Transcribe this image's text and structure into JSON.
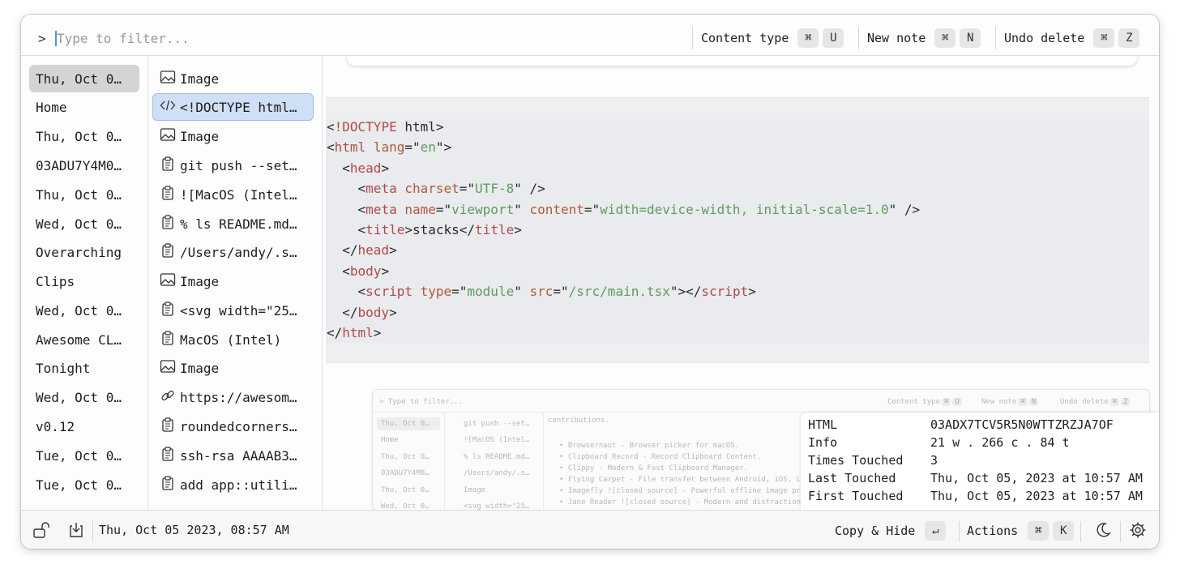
{
  "filter": {
    "prompt": ">",
    "placeholder": "Type to filter..."
  },
  "toolbar": {
    "content_type": {
      "label": "Content type",
      "keys": [
        "⌘",
        "U"
      ]
    },
    "new_note": {
      "label": "New note",
      "keys": [
        "⌘",
        "N"
      ]
    },
    "undo_delete": {
      "label": "Undo delete",
      "keys": [
        "⌘",
        "Z"
      ]
    }
  },
  "stacks": [
    "Thu, Oct 0…",
    "Home",
    "Thu, Oct 0…",
    "03ADU7Y4M0…",
    "Thu, Oct 0…",
    "Wed, Oct 0…",
    "Overarching",
    "Clips",
    "Wed, Oct 0…",
    "Awesome CL…",
    "Tonight",
    "Wed, Oct 0…",
    "v0.12",
    "Tue, Oct 0…",
    "Tue, Oct 0…"
  ],
  "items": [
    {
      "icon": "image-icon",
      "text": "Image"
    },
    {
      "icon": "code-icon",
      "text": "<!DOCTYPE html…"
    },
    {
      "icon": "image-icon",
      "text": "Image"
    },
    {
      "icon": "clipboard-icon",
      "text": "git push --set…"
    },
    {
      "icon": "clipboard-icon",
      "text": "![MacOS (Intel…"
    },
    {
      "icon": "clipboard-icon",
      "text": "% ls README.md…"
    },
    {
      "icon": "clipboard-icon",
      "text": "/Users/andy/.s…"
    },
    {
      "icon": "image-icon",
      "text": "Image"
    },
    {
      "icon": "clipboard-icon",
      "text": "<svg width=\"25…"
    },
    {
      "icon": "clipboard-icon",
      "text": "MacOS (Intel)"
    },
    {
      "icon": "image-icon",
      "text": "Image"
    },
    {
      "icon": "link-icon",
      "text": "https://awesom…"
    },
    {
      "icon": "clipboard-icon",
      "text": "roundedcorners…"
    },
    {
      "icon": "clipboard-icon",
      "text": "ssh-rsa AAAAB3…"
    },
    {
      "icon": "clipboard-icon",
      "text": "add app::utili…"
    }
  ],
  "code_lines": [
    [
      [
        "p",
        "<"
      ],
      [
        "t",
        "!DOCTYPE"
      ],
      [
        "p",
        " html>"
      ]
    ],
    [
      [
        "p",
        "<"
      ],
      [
        "t",
        "html"
      ],
      [
        "p",
        " "
      ],
      [
        "a",
        "lang"
      ],
      [
        "p",
        "=\""
      ],
      [
        "s",
        "en"
      ],
      [
        "p",
        "\">"
      ]
    ],
    [
      [
        "p",
        "  <"
      ],
      [
        "t",
        "head"
      ],
      [
        "p",
        ">"
      ]
    ],
    [
      [
        "p",
        "    <"
      ],
      [
        "t",
        "meta"
      ],
      [
        "p",
        " "
      ],
      [
        "a",
        "charset"
      ],
      [
        "p",
        "=\""
      ],
      [
        "s",
        "UTF-8"
      ],
      [
        "p",
        "\" />"
      ]
    ],
    [
      [
        "p",
        "    <"
      ],
      [
        "t",
        "meta"
      ],
      [
        "p",
        " "
      ],
      [
        "a",
        "name"
      ],
      [
        "p",
        "=\""
      ],
      [
        "s",
        "viewport"
      ],
      [
        "p",
        "\" "
      ],
      [
        "a",
        "content"
      ],
      [
        "p",
        "=\""
      ],
      [
        "s",
        "width=device-width, initial-scale=1.0"
      ],
      [
        "p",
        "\" />"
      ]
    ],
    [
      [
        "p",
        "    <"
      ],
      [
        "t",
        "title"
      ],
      [
        "p",
        ">stacks</"
      ],
      [
        "t",
        "title"
      ],
      [
        "p",
        ">"
      ]
    ],
    [
      [
        "p",
        "  </"
      ],
      [
        "t",
        "head"
      ],
      [
        "p",
        ">"
      ]
    ],
    [
      [
        "p",
        "  <"
      ],
      [
        "t",
        "body"
      ],
      [
        "p",
        ">"
      ]
    ],
    [
      [
        "p",
        "    <"
      ],
      [
        "t",
        "script"
      ],
      [
        "p",
        " "
      ],
      [
        "a",
        "type"
      ],
      [
        "p",
        "=\""
      ],
      [
        "s",
        "module"
      ],
      [
        "p",
        "\" "
      ],
      [
        "a",
        "src"
      ],
      [
        "p",
        "=\""
      ],
      [
        "s",
        "/src/main.tsx"
      ],
      [
        "p",
        "\"></"
      ],
      [
        "t",
        "script"
      ],
      [
        "p",
        ">"
      ]
    ],
    [
      [
        "p",
        "  </"
      ],
      [
        "t",
        "body"
      ],
      [
        "p",
        ">"
      ]
    ],
    [
      [
        "p",
        "</"
      ],
      [
        "t",
        "html"
      ],
      [
        "p",
        ">"
      ]
    ]
  ],
  "mini": {
    "filter": "> Type to filter...",
    "toolbar": [
      {
        "label": "Content type",
        "keys": [
          "⌘",
          "U"
        ]
      },
      {
        "label": "New note",
        "keys": [
          "⌘",
          "N"
        ]
      },
      {
        "label": "Undo delete",
        "keys": [
          "⌘",
          "Z"
        ]
      }
    ],
    "stacks": [
      "Thu, Oct 0…",
      "Home",
      "Thu, Oct 0…",
      "03ADU7Y4M0…",
      "Thu, Oct 0…",
      "Wed, Oct 0…"
    ],
    "items": [
      "git push --set…",
      "![MacOS (Intel…",
      "% ls README.md…",
      "/Users/andy/.s…",
      "Image",
      "<svg width=\"25…"
    ],
    "content_head": "contributions.",
    "bullets": [
      "• Browsernaut - Browser picker for macOS.",
      "• Clipboard Record - Record Clipboard Content.",
      "• Clippy - Modern & Fast Clipboard Manager.",
      "• Flying Carpet - File transfer between Android, iOS, Li",
      "• Imagefly ![closed source] - Powerful offline image pro",
      "• Jane Reader ![closed source] - Modern and distraction-"
    ]
  },
  "info": [
    {
      "key": "HTML",
      "value": "03ADX7TCV5R5N0WTTZRZJA7OF"
    },
    {
      "key": "Info",
      "value": "21 w . 266 c . 84 t"
    },
    {
      "key": "Times Touched",
      "value": "3"
    },
    {
      "key": "Last Touched",
      "value": "Thu, Oct 05, 2023 at 10:57 AM"
    },
    {
      "key": "First Touched",
      "value": "Thu, Oct 05, 2023 at 10:57 AM"
    }
  ],
  "bottom": {
    "timestamp": "Thu, Oct 05 2023, 08:57 AM",
    "copy_hide": {
      "label": "Copy & Hide",
      "key": "↵"
    },
    "actions": {
      "label": "Actions",
      "keys": [
        "⌘",
        "K"
      ]
    },
    "icons": [
      "unlock-icon",
      "download-icon",
      "moon-icon",
      "gear-icon"
    ]
  }
}
